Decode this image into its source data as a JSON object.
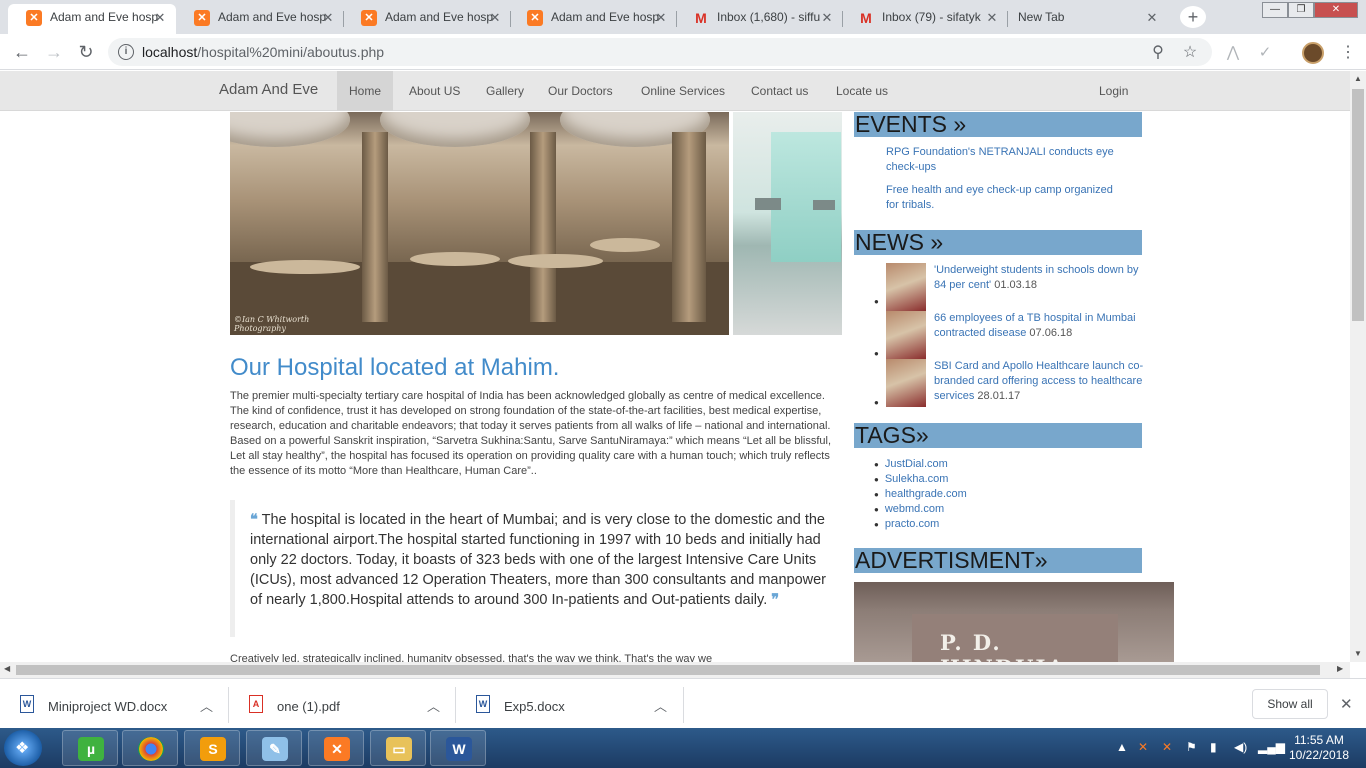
{
  "browser": {
    "tabs": [
      {
        "title": "Adam and Eve hosp",
        "icon": "xampp-icon",
        "active": true
      },
      {
        "title": "Adam and Eve hosp",
        "icon": "xampp-icon"
      },
      {
        "title": "Adam and Eve hosp",
        "icon": "xampp-icon"
      },
      {
        "title": "Adam and Eve hosp",
        "icon": "xampp-icon"
      },
      {
        "title": "Inbox (1,680) - siffu",
        "icon": "gmail-icon"
      },
      {
        "title": "Inbox (79) - sifatyk",
        "icon": "gmail-icon"
      },
      {
        "title": "New Tab",
        "icon": "none"
      }
    ],
    "url_host": "localhost",
    "url_path": "/hospital%20mini/aboutus.php"
  },
  "site": {
    "brand": "Adam And Eve",
    "nav": [
      "Home",
      "About US",
      "Gallery",
      "Our Doctors",
      "Online Services",
      "Contact us",
      "Locate us"
    ],
    "login": "Login"
  },
  "hero": {
    "credit_line1": "©Ian C Whitworth",
    "credit_line2": "Photography"
  },
  "main": {
    "title": "Our Hospital located at Mahim.",
    "paragraph": "The premier multi-specialty tertiary care hospital of India has been acknowledged globally as centre of medical excellence. The kind of confidence, trust it has developed on strong foundation of the state-of-the-art facilities, best medical expertise, research, education and charitable endeavors; that today it serves patients from all walks of life – national and international. Based on a powerful Sanskrit inspiration, “Sarvetra Sukhina:Santu, Sarve SantuNiramaya:” which means “Let all be blissful, Let all stay healthy”, the hospital has focused its operation on providing quality care with a human touch; which truly reflects the essence of its motto “More than Healthcare, Human Care”..",
    "quote": "The hospital is located in the heart of Mumbai; and is very close to the domestic and the international airport.The hospital started functioning in 1997 with 10 beds and initially had only 22 doctors. Today, it boasts of 323 beds with one of the largest Intensive Care Units (ICUs), most advanced 12 Operation Theaters, more than 300 consultants and manpower of nearly 1,800.Hospital attends to around 300 In-patients and Out-patients daily.",
    "quote_open": "❝",
    "quote_close": "❞",
    "paragraph2": "Creatively led, strategically inclined, humanity obsessed, that's the way we think. That's the way we"
  },
  "sidebar": {
    "events_heading": "EVENTS »",
    "events": [
      "RPG Foundation's NETRANJALI conducts eye check-ups",
      "Free health and eye check-up camp organized for tribals."
    ],
    "news_heading": "NEWS »",
    "news": [
      {
        "text": "'Underweight students in schools down by 84 per cent'",
        "date": "01.03.18"
      },
      {
        "text": "66 employees of a TB hospital in Mumbai contracted disease",
        "date": "07.06.18"
      },
      {
        "text": "SBI Card and Apollo Healthcare launch co-branded card offering access to healthcare services",
        "date": "28.01.17"
      }
    ],
    "tags_heading": "TAGS»",
    "tags": [
      "JustDial.com",
      "Sulekha.com",
      "healthgrade.com",
      "webmd.com",
      "practo.com"
    ],
    "ad_heading": "ADVERTISMENT»",
    "ad_sign": "P. D. HINDUJA"
  },
  "downloads": {
    "items": [
      {
        "name": "Miniproject WD.docx",
        "type": "word"
      },
      {
        "name": "one (1).pdf",
        "type": "pdf"
      },
      {
        "name": "Exp5.docx",
        "type": "word"
      }
    ],
    "show_all": "Show all"
  },
  "taskbar": {
    "time": "11:55 AM",
    "date": "10/22/2018"
  },
  "colors": {
    "accent": "#428bca",
    "sidebar_header": "#78a7cc",
    "link": "#3a74b5"
  }
}
